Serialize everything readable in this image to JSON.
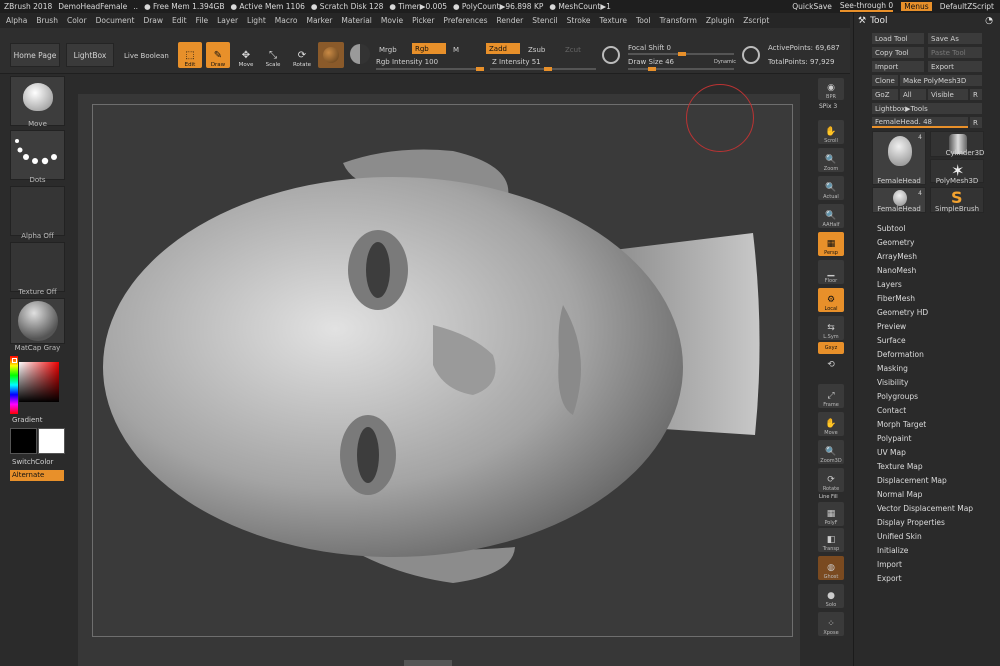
{
  "titlebar": {
    "app": "ZBrush 2018",
    "doc": "DemoHeadFemale",
    "dots": "..",
    "free_mem": "● Free Mem 1.394GB",
    "active_mem": "● Active Mem 1106",
    "scratch": "● Scratch Disk 128",
    "timer": "● Timer▶0.005",
    "polycount": "● PolyCount▶96.898 KP",
    "meshcount": "● MeshCount▶1",
    "quicksave": "QuickSave",
    "seethrough": "See-through 0",
    "menus": "Menus",
    "defaultzscript": "DefaultZScript"
  },
  "menubar": [
    "Alpha",
    "Brush",
    "Color",
    "Document",
    "Draw",
    "Edit",
    "File",
    "Layer",
    "Light",
    "Macro",
    "Marker",
    "Material",
    "Movie",
    "Picker",
    "Preferences",
    "Render",
    "Stencil",
    "Stroke",
    "Texture",
    "Tool",
    "Transform",
    "Zplugin",
    "Zscript"
  ],
  "shelf": {
    "home_page": "Home Page",
    "lightbox": "LightBox",
    "live_boolean": "Live Boolean",
    "edit": "Edit",
    "draw": "Draw",
    "move": "Move",
    "scale": "Scale",
    "rotate": "Rotate",
    "mrgb": "Mrgb",
    "rgb": "Rgb",
    "m": "M",
    "rgb_intensity": "Rgb Intensity 100",
    "zadd": "Zadd",
    "zsub": "Zsub",
    "zcut": "Zcut",
    "z_intensity": "Z Intensity 51",
    "focal_shift": "Focal Shift 0",
    "draw_size": "Draw Size 46",
    "dynamic": "Dynamic",
    "active_points": "ActivePoints: 69,687",
    "total_points": "TotalPoints: 97,929"
  },
  "leftshelf": {
    "brush": "Move",
    "stroke": "Dots",
    "alpha": "Alpha Off",
    "texture": "Texture Off",
    "material": "MatCap Gray",
    "gradient": "Gradient",
    "switchcolor": "SwitchColor",
    "alternate": "Alternate"
  },
  "rtoolbar": {
    "bpr": "BPR",
    "spix": "SPix 3",
    "scroll": "Scroll",
    "zoom": "Zoom",
    "actual": "Actual",
    "aahalf": "AAHalf",
    "persp": "Persp",
    "floor": "Floor",
    "local": "Local",
    "lsym": "L.Sym",
    "gxyz": "Gxyz",
    "frame": "Frame",
    "move": "Move",
    "zoom3d": "Zoom3D",
    "rotate": "Rotate",
    "linefill": "Line Fill",
    "polyf": "PolyF",
    "transp": "Transp",
    "ghost": "Ghost",
    "solo": "Solo",
    "xpose": "Xpose"
  },
  "toolpanel": {
    "title": "Tool",
    "load_tool": "Load Tool",
    "save_as": "Save As",
    "copy_tool": "Copy Tool",
    "paste_tool": "Paste Tool",
    "import": "Import",
    "export": "Export",
    "clone": "Clone",
    "make_polymesh": "Make PolyMesh3D",
    "goz": "GoZ",
    "all": "All",
    "visible": "Visible",
    "r": "R",
    "lightbox_tools": "Lightbox▶Tools",
    "current_tool": "FemaleHead. 48",
    "thumbs": [
      {
        "name": "FemaleHead",
        "count": "4"
      },
      {
        "name": "Cylinder3D",
        "count": ""
      },
      {
        "name": "PolyMesh3D",
        "count": ""
      },
      {
        "name": "FemaleHead",
        "count": "4"
      },
      {
        "name": "SimpleBrush",
        "count": ""
      }
    ],
    "items": [
      "Subtool",
      "Geometry",
      "ArrayMesh",
      "NanoMesh",
      "Layers",
      "FiberMesh",
      "Geometry HD",
      "Preview",
      "Surface",
      "Deformation",
      "Masking",
      "Visibility",
      "Polygroups",
      "Contact",
      "Morph Target",
      "Polypaint",
      "UV Map",
      "Texture Map",
      "Displacement Map",
      "Normal Map",
      "Vector Displacement Map",
      "Display Properties",
      "Unified Skin",
      "Initialize",
      "Import",
      "Export"
    ]
  }
}
